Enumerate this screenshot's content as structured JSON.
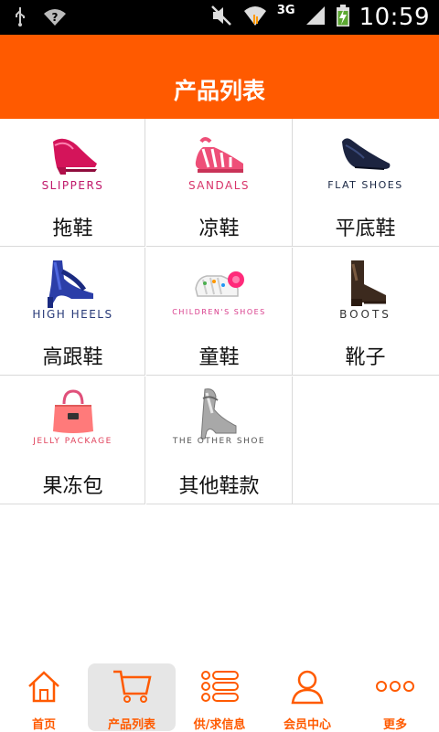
{
  "status_bar": {
    "time": "10:59",
    "network": "3G",
    "icons": [
      "usb-icon",
      "wifi-question-icon",
      "mute-icon",
      "wifi-icon",
      "signal-icon",
      "battery-charging-icon"
    ]
  },
  "header": {
    "title": "产品列表"
  },
  "products": [
    {
      "en": "SLIPPERS",
      "zh": "拖鞋",
      "en_color": "#c0186a",
      "icon": "slipper-icon"
    },
    {
      "en": "SANDALS",
      "zh": "凉鞋",
      "en_color": "#d8346a",
      "icon": "sandal-icon"
    },
    {
      "en": "FLAT SHOES",
      "zh": "平底鞋",
      "en_color": "#1a2744",
      "icon": "flat-shoe-icon"
    },
    {
      "en": "HIGH HEELS",
      "zh": "高跟鞋",
      "en_color": "#283a78",
      "icon": "high-heel-icon"
    },
    {
      "en": "CHILDREN'S SHOES",
      "zh": "童鞋",
      "en_color": "#d83a8a",
      "icon": "children-shoe-icon"
    },
    {
      "en": "BOOTS",
      "zh": "靴子",
      "en_color": "#333333",
      "icon": "boot-icon"
    },
    {
      "en": "JELLY PACKAGE",
      "zh": "果冻包",
      "en_color": "#e0405a",
      "icon": "handbag-icon"
    },
    {
      "en": "THE OTHER SHOE",
      "zh": "其他鞋款",
      "en_color": "#555555",
      "icon": "other-shoe-icon"
    }
  ],
  "tabbar": {
    "accent": "#ff5a00",
    "tabs": [
      {
        "label": "首页",
        "icon": "home-icon",
        "active": false
      },
      {
        "label": "产品列表",
        "icon": "cart-icon",
        "active": true
      },
      {
        "label": "供/求信息",
        "icon": "list-icon",
        "active": false
      },
      {
        "label": "会员中心",
        "icon": "user-icon",
        "active": false
      },
      {
        "label": "更多",
        "icon": "more-icon",
        "active": false
      }
    ]
  }
}
